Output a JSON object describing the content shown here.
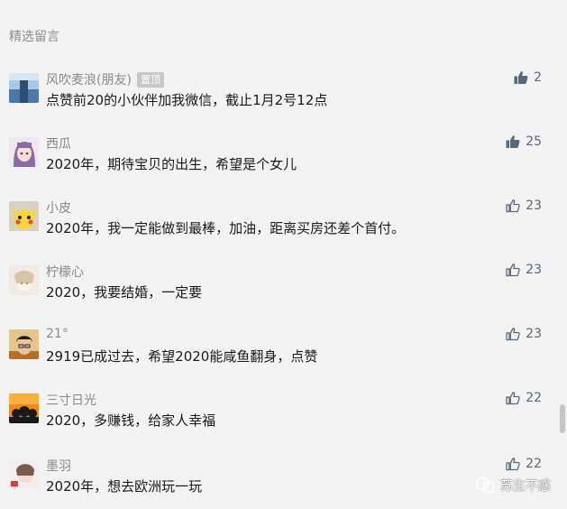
{
  "section": {
    "title": "精选留言"
  },
  "comments": [
    {
      "name": "风吹麦浪(朋友)",
      "badge": "置顶",
      "text": "点赞前20的小伙伴加我微信，截止1月2号12点",
      "likes": "2",
      "liked": true
    },
    {
      "name": "西瓜",
      "text": "2020年，期待宝贝的出生，希望是个女儿",
      "likes": "25",
      "liked": true
    },
    {
      "name": "小皮",
      "text": "2020年，我一定能做到最棒，加油，距离买房还差个首付。",
      "likes": "23",
      "liked": false
    },
    {
      "name": "柠檬心",
      "text": "2020，我要结婚，一定要",
      "likes": "23",
      "liked": false
    },
    {
      "name": "21°",
      "text": "2919已成过去，希望2020能咸鱼翻身，点赞",
      "likes": "23",
      "liked": false
    },
    {
      "name": "三寸日光",
      "text": "2020，多赚钱，给家人幸福",
      "likes": "22",
      "liked": false
    },
    {
      "name": "墨羽",
      "text": "2020年，想去欧洲玩一玩",
      "likes": "22",
      "liked": false
    }
  ],
  "watermark": {
    "label": "苏生不惑",
    "icon": "wechat-official-account-icon"
  },
  "colors": {
    "like_active": "#58677a",
    "name_gray": "#8a8a8a",
    "background": "#f3f3f3"
  }
}
